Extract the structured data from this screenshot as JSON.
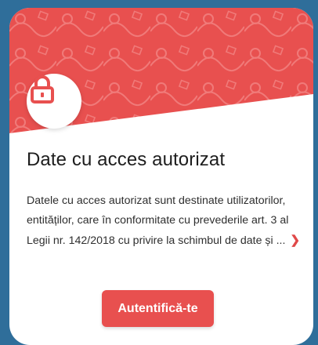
{
  "card": {
    "title": "Date cu acces autorizat",
    "description": "Datele cu acces autorizat sunt destinate utilizatorilor, entităților, care în conformitate cu prevederile art. 3 al Legii nr. 142/2018 cu privire la schimbul de date și ...",
    "more_icon": "chevron-right-icon",
    "login_label": "Autentifică-te",
    "lock_icon": "lock-icon"
  },
  "colors": {
    "accent": "#e8504f",
    "background": "#2f6e9a",
    "card": "#ffffff"
  }
}
